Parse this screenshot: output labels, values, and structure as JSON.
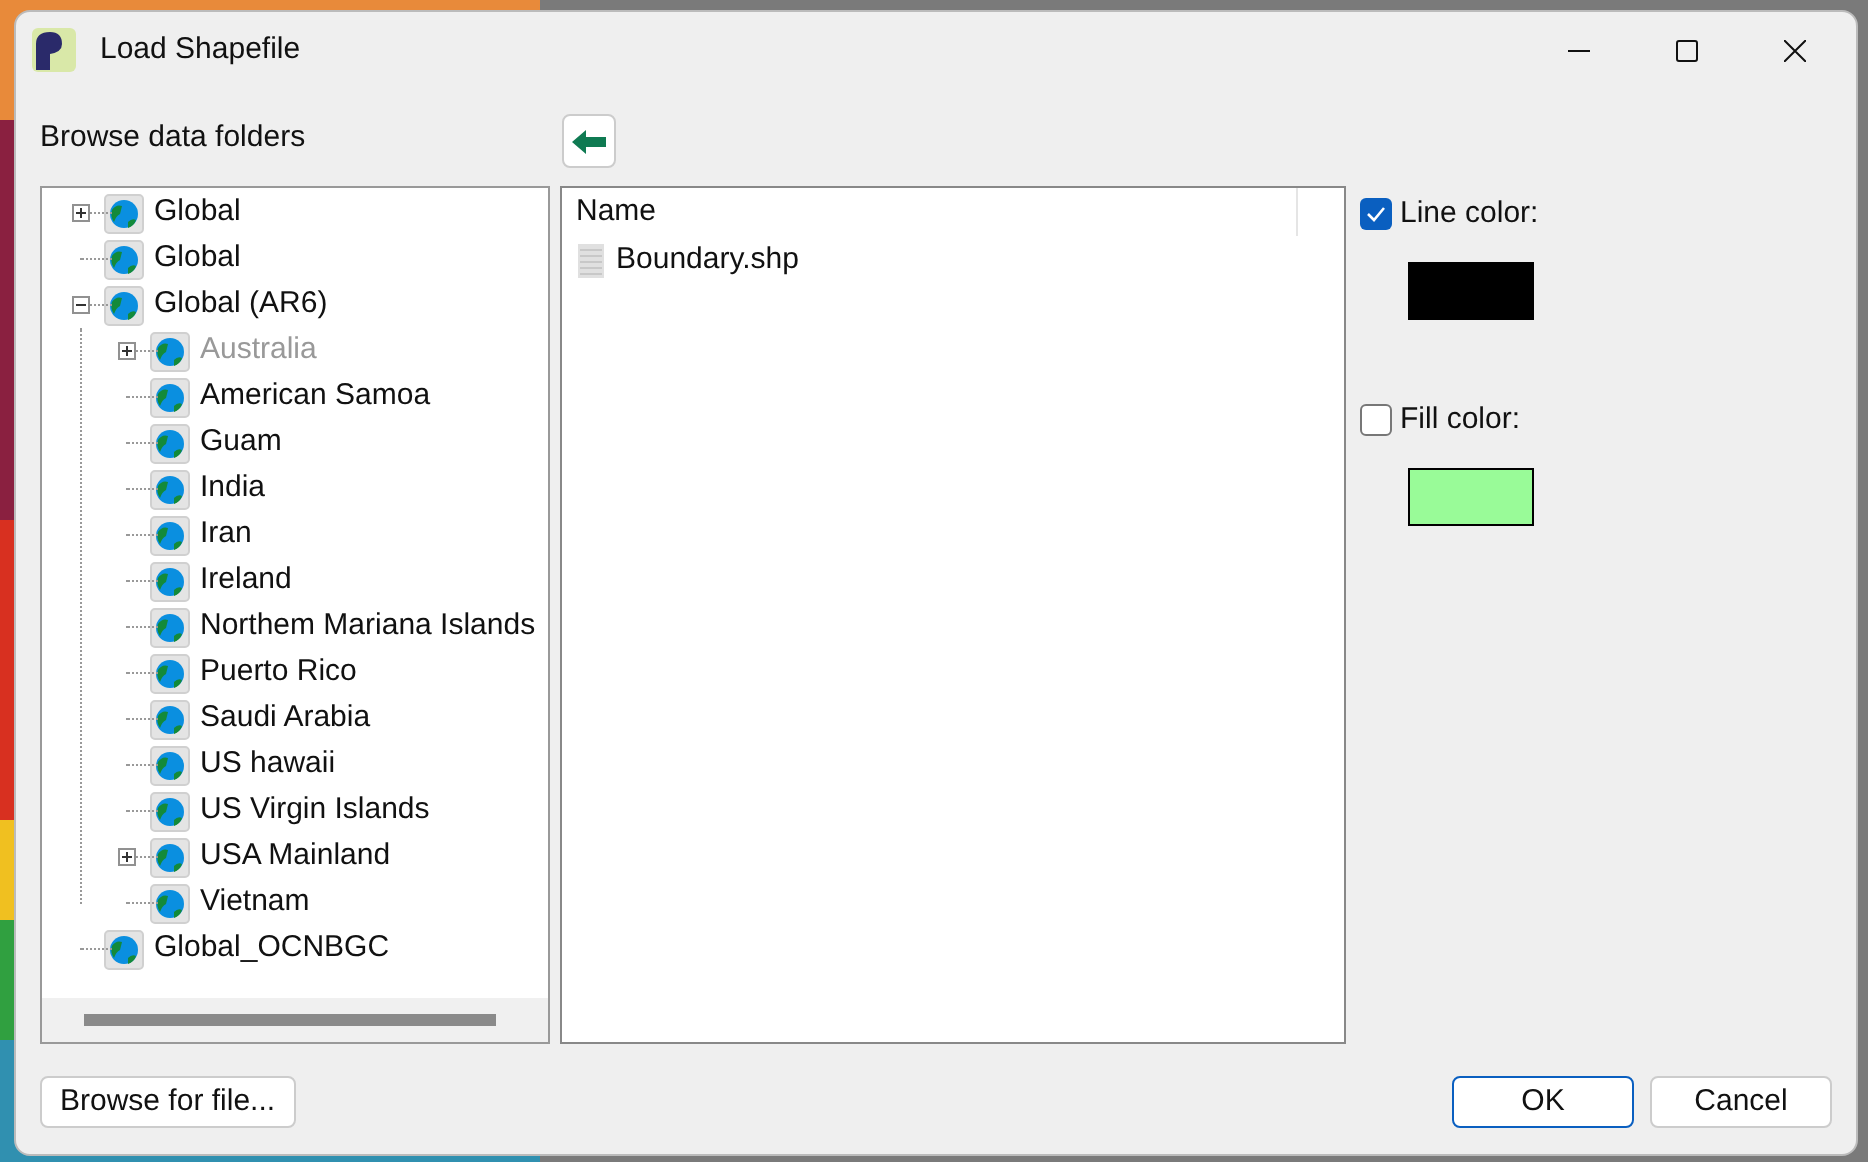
{
  "window": {
    "title": "Load Shapefile"
  },
  "browse_label": "Browse data folders",
  "tree": [
    {
      "label": "Global",
      "kind": "collapsed",
      "disabled": false
    },
    {
      "label": "Global",
      "kind": "leaf",
      "disabled": false
    },
    {
      "label": "Global (AR6)",
      "kind": "expanded",
      "disabled": false,
      "children": [
        {
          "label": "Australia",
          "kind": "collapsed",
          "disabled": true
        },
        {
          "label": "American Samoa",
          "kind": "leaf",
          "disabled": false
        },
        {
          "label": "Guam",
          "kind": "leaf",
          "disabled": false
        },
        {
          "label": "India",
          "kind": "leaf",
          "disabled": false
        },
        {
          "label": "Iran",
          "kind": "leaf",
          "disabled": false
        },
        {
          "label": "Ireland",
          "kind": "leaf",
          "disabled": false
        },
        {
          "label": "Northem Mariana Islands",
          "kind": "leaf",
          "disabled": false
        },
        {
          "label": "Puerto Rico",
          "kind": "leaf",
          "disabled": false
        },
        {
          "label": "Saudi Arabia",
          "kind": "leaf",
          "disabled": false
        },
        {
          "label": "US hawaii",
          "kind": "leaf",
          "disabled": false
        },
        {
          "label": "US Virgin Islands",
          "kind": "leaf",
          "disabled": false
        },
        {
          "label": "USA Mainland",
          "kind": "collapsed",
          "disabled": false
        },
        {
          "label": "Vietnam",
          "kind": "leaf",
          "disabled": false
        }
      ]
    },
    {
      "label": "Global_OCNBGC",
      "kind": "leaf",
      "disabled": false
    }
  ],
  "file_list": {
    "columns": [
      "Name"
    ],
    "files": [
      "Boundary.shp"
    ]
  },
  "options": [
    {
      "label": "Line color:",
      "checked": true,
      "color": "#000000"
    },
    {
      "label": "Fill color:",
      "checked": false,
      "color": "#99fb98"
    }
  ],
  "buttons": {
    "browse": "Browse for file...",
    "ok": "OK",
    "cancel": "Cancel"
  }
}
